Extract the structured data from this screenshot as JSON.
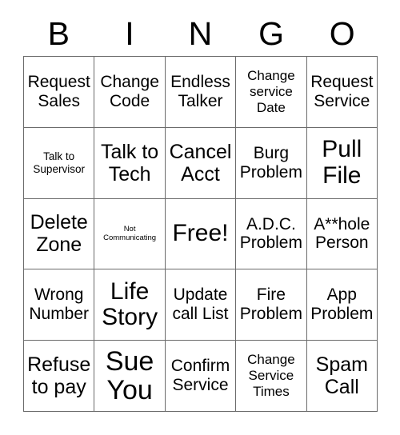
{
  "card": {
    "header_letters": [
      "B",
      "I",
      "N",
      "G",
      "O"
    ],
    "grid_size": 5,
    "text_color": "#000000",
    "grid_line_color": "#6b6b6b",
    "background_color": "#ffffff",
    "cells": [
      {
        "text": "Request\nSales",
        "size": "m"
      },
      {
        "text": "Change\nCode",
        "size": "m"
      },
      {
        "text": "Endless\nTalker",
        "size": "m"
      },
      {
        "text": "Change\nservice\nDate",
        "size": "s"
      },
      {
        "text": "Request\nService",
        "size": "m"
      },
      {
        "text": "Talk to\nSupervisor",
        "size": "xs"
      },
      {
        "text": "Talk to\nTech",
        "size": "l"
      },
      {
        "text": "Cancel\nAcct",
        "size": "l"
      },
      {
        "text": "Burg\nProblem",
        "size": "m"
      },
      {
        "text": "Pull\nFile",
        "size": "xl"
      },
      {
        "text": "Delete\nZone",
        "size": "l"
      },
      {
        "text": "Not\nCommunicating",
        "size": "xxs"
      },
      {
        "text": "Free!",
        "size": "xl"
      },
      {
        "text": "A.D.C.\nProblem",
        "size": "m"
      },
      {
        "text": "A**hole\nPerson",
        "size": "m"
      },
      {
        "text": "Wrong\nNumber",
        "size": "m"
      },
      {
        "text": "Life\nStory",
        "size": "xl"
      },
      {
        "text": "Update\ncall List",
        "size": "m"
      },
      {
        "text": "Fire\nProblem",
        "size": "m"
      },
      {
        "text": "App\nProblem",
        "size": "m"
      },
      {
        "text": "Refuse\nto pay",
        "size": "l"
      },
      {
        "text": "Sue\nYou",
        "size": "xxl"
      },
      {
        "text": "Confirm\nService",
        "size": "m"
      },
      {
        "text": "Change\nService\nTimes",
        "size": "s"
      },
      {
        "text": "Spam\nCall",
        "size": "l"
      }
    ]
  }
}
